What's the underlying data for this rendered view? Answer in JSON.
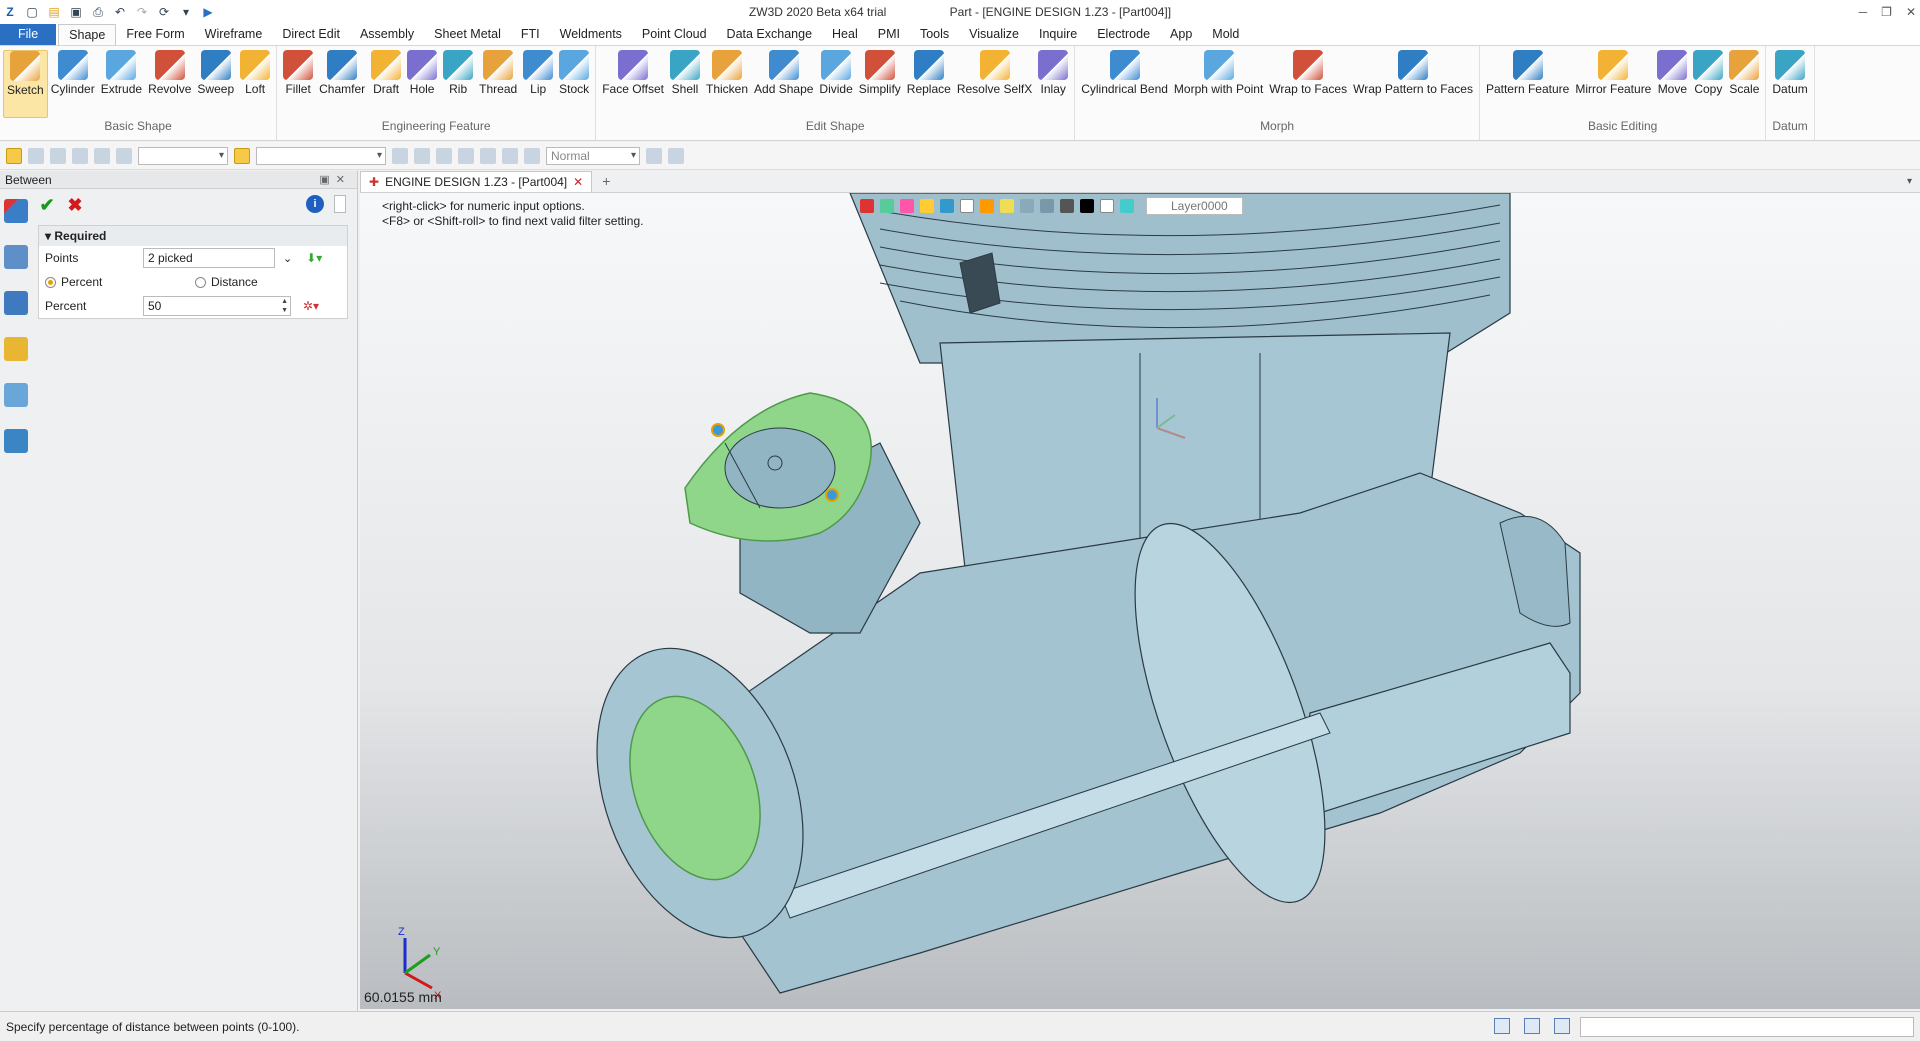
{
  "app": {
    "title_app": "ZW3D 2020 Beta x64 trial",
    "title_doc": "Part - [ENGINE DESIGN 1.Z3 - [Part004]]"
  },
  "menu": {
    "file": "File",
    "items": [
      "Shape",
      "Free Form",
      "Wireframe",
      "Direct Edit",
      "Assembly",
      "Sheet Metal",
      "FTI",
      "Weldments",
      "Point Cloud",
      "Data Exchange",
      "Heal",
      "PMI",
      "Tools",
      "Visualize",
      "Inquire",
      "Electrode",
      "App",
      "Mold"
    ]
  },
  "ribbon": {
    "groups": [
      {
        "title": "Basic Shape",
        "buttons": [
          "Sketch",
          "Cylinder",
          "Extrude",
          "Revolve",
          "Sweep",
          "Loft"
        ]
      },
      {
        "title": "Engineering Feature",
        "buttons": [
          "Fillet",
          "Chamfer",
          "Draft",
          "Hole",
          "Rib",
          "Thread",
          "Lip",
          "Stock"
        ]
      },
      {
        "title": "Edit Shape",
        "buttons": [
          "Face Offset",
          "Shell",
          "Thicken",
          "Add Shape",
          "Divide",
          "Simplify",
          "Replace",
          "Resolve SelfX",
          "Inlay"
        ]
      },
      {
        "title": "Morph",
        "buttons": [
          "Cylindrical Bend",
          "Morph with Point",
          "Wrap to Faces",
          "Wrap Pattern to Faces"
        ]
      },
      {
        "title": "Basic Editing",
        "buttons": [
          "Pattern Feature",
          "Mirror Feature",
          "Move",
          "Copy",
          "Scale"
        ]
      },
      {
        "title": "Datum",
        "buttons": [
          "Datum"
        ]
      }
    ]
  },
  "toolbar2": {
    "mode": "Normal"
  },
  "panel": {
    "title": "Between",
    "section": "Required",
    "points_label": "Points",
    "points_value": "2 picked",
    "percent_radio": "Percent",
    "distance_radio": "Distance",
    "percent_label": "Percent",
    "percent_value": "50",
    "help": "i"
  },
  "doc": {
    "tab": "ENGINE DESIGN 1.Z3 - [Part004]",
    "hint1": "<right-click> for numeric input options.",
    "hint2": "<F8> or <Shift-roll> to find next valid filter setting.",
    "layer": "Layer0000",
    "measure": "60.0155 mm",
    "axes": {
      "x": "X",
      "y": "Y",
      "z": "Z"
    }
  },
  "status": {
    "text": "Specify percentage of distance between points (0-100)."
  },
  "colors": {
    "accent": "#2b6fc2",
    "model": "#a9c9d6",
    "selection": "#8fd68a"
  }
}
